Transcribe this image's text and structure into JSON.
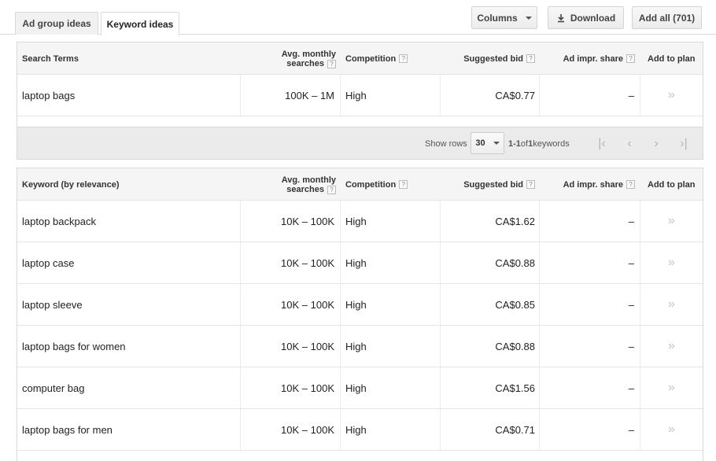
{
  "tabs": [
    {
      "label": "Ad group ideas",
      "active": false
    },
    {
      "label": "Keyword ideas",
      "active": true
    }
  ],
  "toolbar": {
    "columns_label": "Columns",
    "download_label": "Download",
    "add_all_label": "Add all (701)"
  },
  "search_table": {
    "headers": {
      "term": "Search Terms",
      "searches_line1": "Avg. monthly",
      "searches_line2": "searches",
      "competition": "Competition",
      "bid": "Suggested bid",
      "impr": "Ad impr. share",
      "add": "Add to plan"
    },
    "rows": [
      {
        "term": "laptop bags",
        "searches": "100K – 1M",
        "competition": "High",
        "bid": "CA$0.77",
        "impr": "–"
      }
    ]
  },
  "pager": {
    "show_rows_label": "Show rows",
    "rows_value": "30",
    "range_start": "1",
    "range_sep": " - ",
    "range_end": "1",
    "of_label": " of ",
    "total": "1",
    "suffix": " keywords"
  },
  "keyword_table": {
    "headers": {
      "term": "Keyword (by relevance)",
      "searches_line1": "Avg. monthly",
      "searches_line2": "searches",
      "competition": "Competition",
      "bid": "Suggested bid",
      "impr": "Ad impr. share",
      "add": "Add to plan"
    },
    "rows": [
      {
        "term": "laptop backpack",
        "searches": "10K – 100K",
        "competition": "High",
        "bid": "CA$1.62",
        "impr": "–"
      },
      {
        "term": "laptop case",
        "searches": "10K – 100K",
        "competition": "High",
        "bid": "CA$0.88",
        "impr": "–"
      },
      {
        "term": "laptop sleeve",
        "searches": "10K – 100K",
        "competition": "High",
        "bid": "CA$0.85",
        "impr": "–"
      },
      {
        "term": "laptop bags for women",
        "searches": "10K – 100K",
        "competition": "High",
        "bid": "CA$0.88",
        "impr": "–"
      },
      {
        "term": "computer bag",
        "searches": "10K – 100K",
        "competition": "High",
        "bid": "CA$1.56",
        "impr": "–"
      },
      {
        "term": "laptop bags for men",
        "searches": "10K – 100K",
        "competition": "High",
        "bid": "CA$0.71",
        "impr": "–"
      }
    ]
  },
  "icons": {
    "help": "?",
    "add_chevron": "»"
  }
}
